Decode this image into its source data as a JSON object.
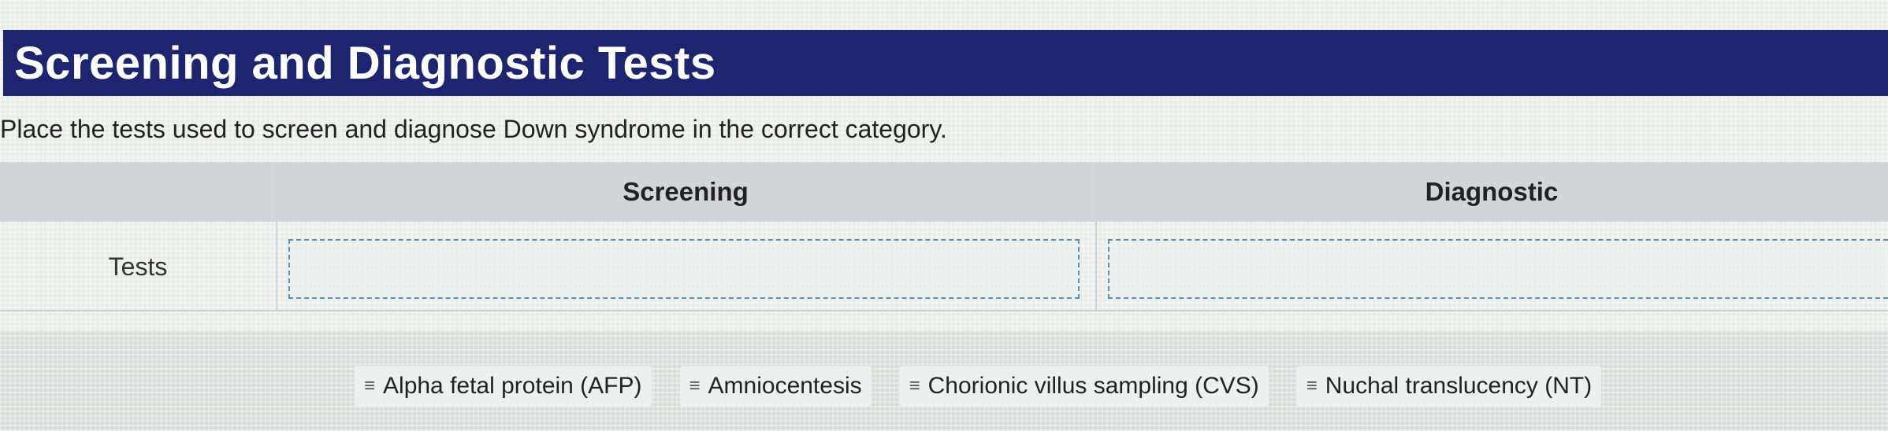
{
  "header": {
    "title": "Screening and Diagnostic Tests"
  },
  "instructions": "Place the tests used to screen and diagnose Down syndrome in the correct category.",
  "table": {
    "columns": [
      "Screening",
      "Diagnostic"
    ],
    "row_label": "Tests"
  },
  "answer_bank": {
    "grip_icon": "≡",
    "items": [
      {
        "label": "Alpha fetal protein (AFP)"
      },
      {
        "label": "Amniocentesis"
      },
      {
        "label": "Chorionic villus sampling (CVS)"
      },
      {
        "label": "Nuchal translucency (NT)"
      }
    ]
  },
  "colors": {
    "header_bg": "#1d2570",
    "drop_border": "#5e8db5"
  }
}
